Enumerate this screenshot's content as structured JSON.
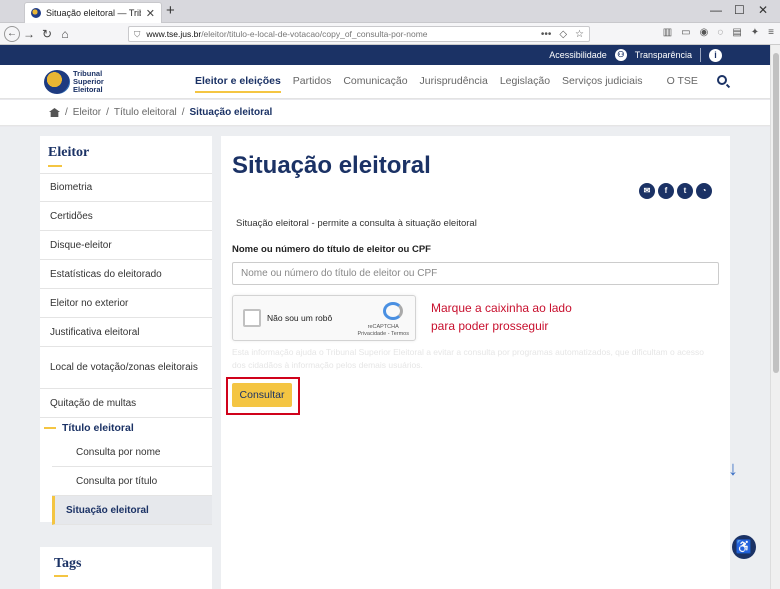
{
  "browser": {
    "tab_title": "Situação eleitoral — Tribunal Su",
    "url_domain": "www.tse.jus.br",
    "url_path": "/eleitor/titulo-e-local-de-votacao/copy_of_consulta-por-nome",
    "url_more": "•••"
  },
  "topbar": {
    "accessibility": "Acessibilidade",
    "transparency": "Transparência"
  },
  "logo": {
    "line1": "Tribunal",
    "line2": "Superior",
    "line3": "Eleitoral"
  },
  "menu": [
    "Eleitor e eleições",
    "Partidos",
    "Comunicação",
    "Jurisprudência",
    "Legislação",
    "Serviços judiciais",
    "O TSE"
  ],
  "breadcrumb": {
    "item1": "Eleitor",
    "item2": "Título eleitoral",
    "current": "Situação eleitoral",
    "sep": "/"
  },
  "sidebar": {
    "title": "Eleitor",
    "items": [
      "Biometria",
      "Certidões",
      "Disque-eleitor",
      "Estatísticas do eleitorado",
      "Eleitor no exterior",
      "Justificativa eleitoral",
      "Local de votação/zonas eleitorais",
      "Quitação de multas"
    ],
    "group": "Título eleitoral",
    "subitems": [
      "Consulta por nome",
      "Consulta por título",
      "Situação eleitoral"
    ]
  },
  "tags": {
    "title": "Tags"
  },
  "main": {
    "title": "Situação eleitoral",
    "description": "Situação eleitoral - permite a consulta à situação eleitoral",
    "field_label": "Nome ou número do título de eleitor ou CPF",
    "field_placeholder": "Nome ou número do título de eleitor ou CPF",
    "captcha_label": "Não sou um robô",
    "captcha_brand": "reCAPTCHA",
    "captcha_links": "Privacidade - Termos",
    "hint_line1": "Marque a caixinha ao lado",
    "hint_line2": "para poder prosseguir",
    "faded_text": "Esta informação ajuda o Tribunal Superior Eleitoral a evitar a consulta por programas automatizados, que dificultam o acesso dos cidadãos à informação pelos demais usuários.",
    "submit": "Consultar"
  },
  "share_icons": [
    "email-icon",
    "facebook-icon",
    "twitter-icon",
    "whatsapp-icon"
  ],
  "colors": {
    "navy": "#1b3265",
    "accent": "#f4c542",
    "hint_red": "#c8102e",
    "highlight_box": "#d0021b"
  }
}
